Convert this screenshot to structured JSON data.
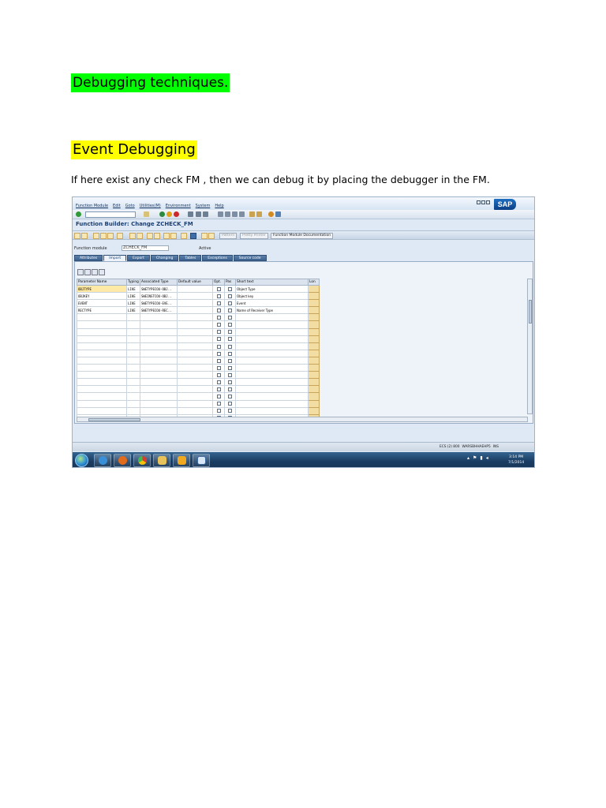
{
  "doc": {
    "heading": "Debugging techniques.",
    "subheading": "Event Debugging",
    "paragraph": "If here exist any check FM , then we can debug it by placing the debugger in the FM."
  },
  "sap_screenshot": {
    "menu": [
      "Function Module",
      "Edit",
      "Goto",
      "Utilities(M)",
      "Environment",
      "System",
      "Help"
    ],
    "logo": "SAP",
    "screen_title": "Function Builder: Change ZCHECK_FM",
    "app_toolbar": {
      "pattern": "Pattern",
      "pretty_printer": "Pretty Printer",
      "fm_documentation": "Function Module Documentation"
    },
    "function_module_label": "Function module",
    "function_module_value": "ZCHECK_FM",
    "function_module_status": "Active",
    "tabs": [
      "Attributes",
      "Import",
      "Export",
      "Changing",
      "Tables",
      "Exceptions",
      "Source code"
    ],
    "active_tab": "Import",
    "table": {
      "columns": [
        "Parameter Name",
        "Typing",
        "Associated Type",
        "Default value",
        "Opt.",
        "Pas",
        "Short text",
        "Lon"
      ],
      "rows": [
        {
          "name": "OBJTYPE",
          "typing": "LIKE",
          "assoc": "SWETYPECOU-OBJ..",
          "default": "",
          "short_text": "Object Type"
        },
        {
          "name": "OBJKEY",
          "typing": "LIKE",
          "assoc": "SWEINSTCOU-OBJ..",
          "default": "",
          "short_text": "Object key"
        },
        {
          "name": "EVENT",
          "typing": "LIKE",
          "assoc": "SWETYPECOU-EVE..",
          "default": "",
          "short_text": "Event"
        },
        {
          "name": "RECTYPE",
          "typing": "LIKE",
          "assoc": "SWETYPECOU-REC..",
          "default": "",
          "short_text": "Name of Receiver Type"
        }
      ]
    },
    "status_bar": {
      "system": "ECS (2) 800",
      "server": "WARSBHHAEHP5",
      "mode": "INS"
    },
    "taskbar_clock": {
      "time": "3:14 PM",
      "date": "7/1/2014"
    }
  }
}
